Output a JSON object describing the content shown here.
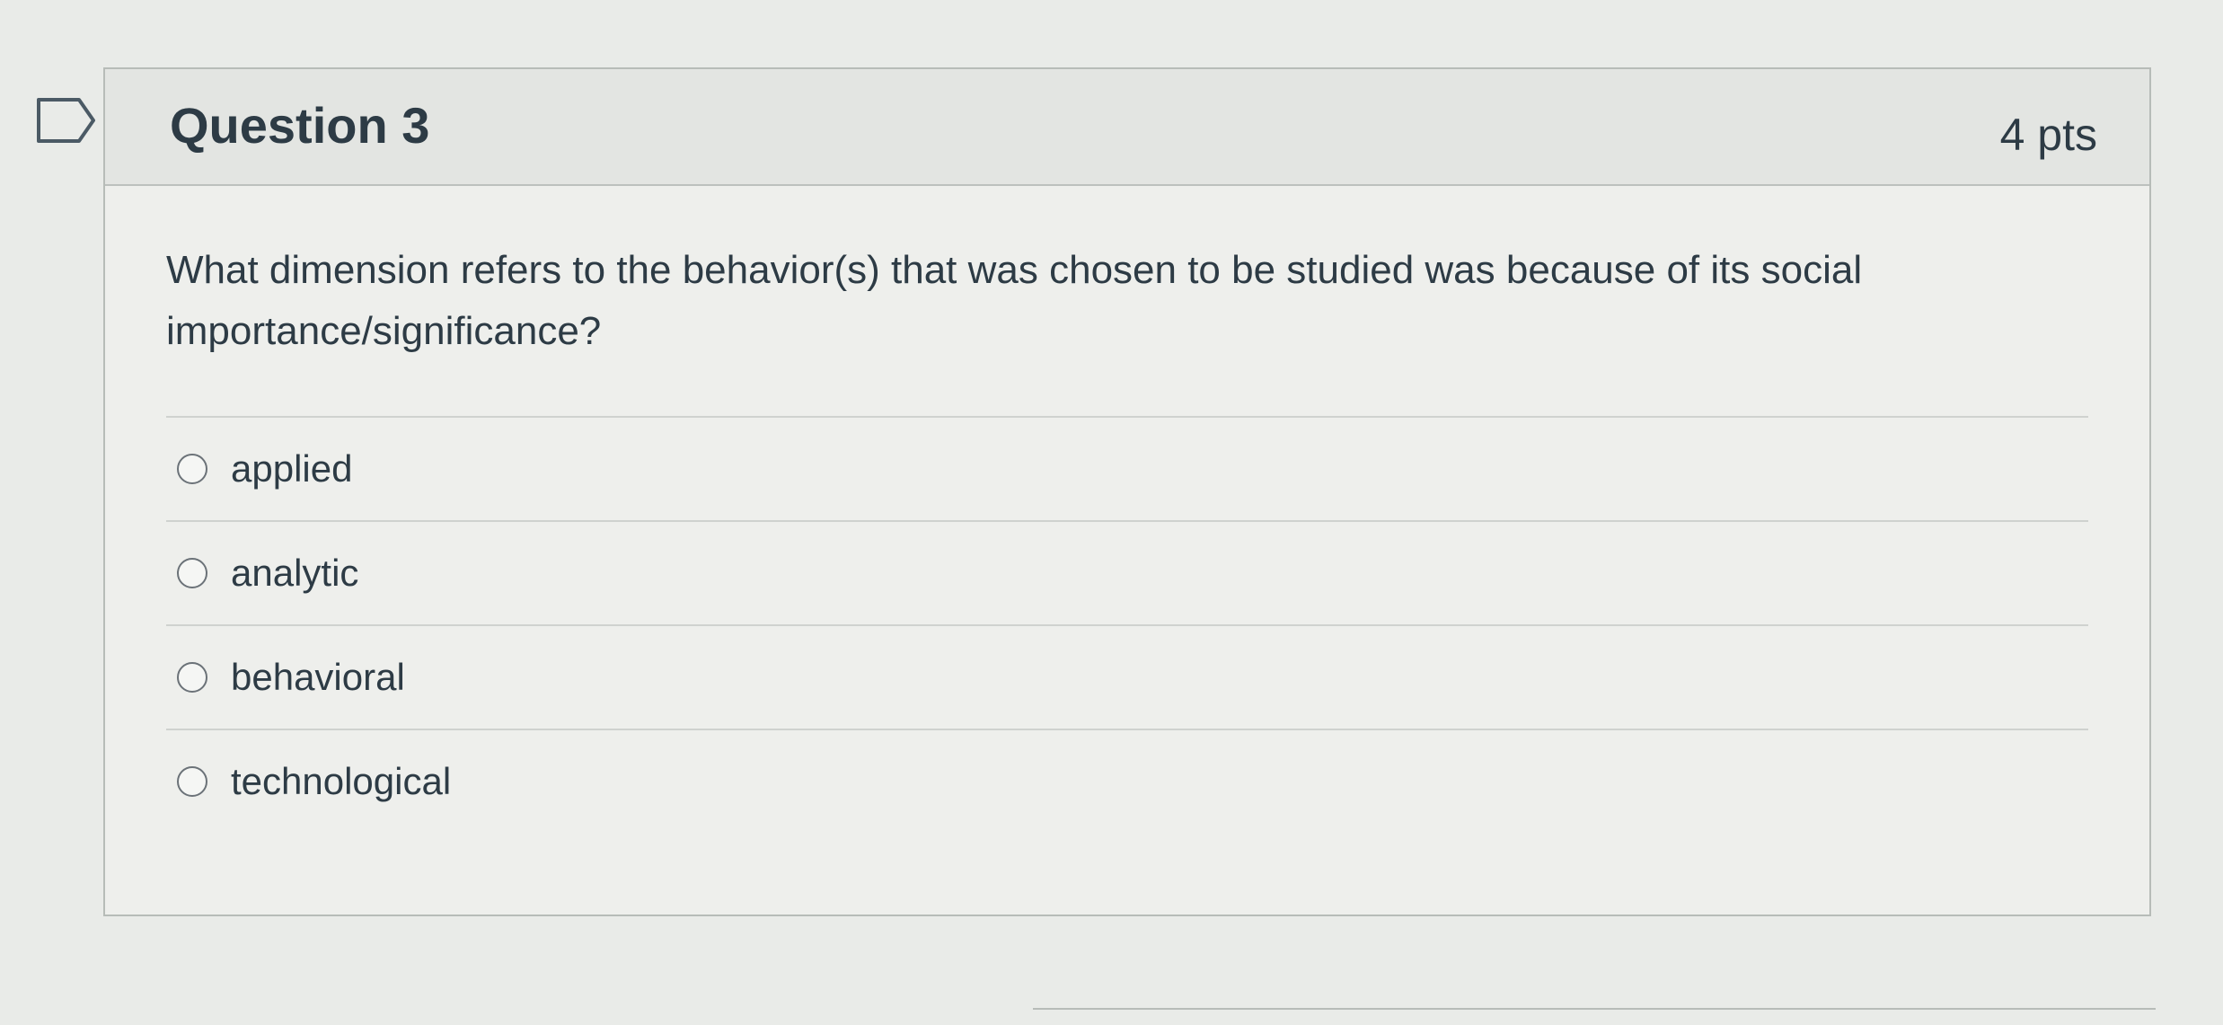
{
  "question": {
    "title": "Question 3",
    "points": "4 pts",
    "text": "What dimension refers to the behavior(s) that was chosen to be studied was because of its social importance/significance?",
    "answers": [
      {
        "label": "applied",
        "selected": false
      },
      {
        "label": "analytic",
        "selected": false
      },
      {
        "label": "behavioral",
        "selected": false
      },
      {
        "label": "technological",
        "selected": false
      }
    ]
  },
  "icons": {
    "flag": "bookmark-flag-icon"
  },
  "colors": {
    "text": "#2d3b45",
    "header_bg": "#e3e5e2",
    "body_bg": "#eeefec",
    "border": "#b7bcb8"
  }
}
